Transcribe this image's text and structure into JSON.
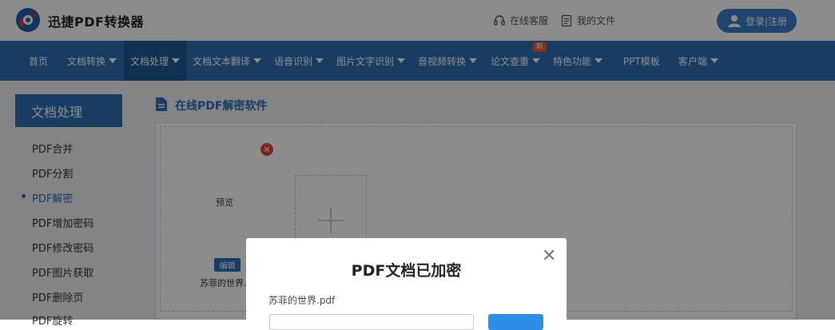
{
  "header": {
    "brand": "迅捷PDF转换器",
    "links": [
      {
        "label": "在线客服"
      },
      {
        "label": "我的文件"
      }
    ],
    "login": "登录|注册"
  },
  "nav": {
    "items": [
      {
        "label": "首页"
      },
      {
        "label": "文档转换"
      },
      {
        "label": "文档处理"
      },
      {
        "label": "文档文本翻译"
      },
      {
        "label": "语音识别"
      },
      {
        "label": "图片文字识别"
      },
      {
        "label": "音视频转换"
      },
      {
        "label": "论文查重"
      },
      {
        "label": "特色功能"
      },
      {
        "label": "PPT模板"
      },
      {
        "label": "客户端"
      }
    ],
    "new_badge": "新"
  },
  "sidebar": {
    "title": "文档处理",
    "items": [
      {
        "label": "PDF合并"
      },
      {
        "label": "PDF分割"
      },
      {
        "label": "PDF解密"
      },
      {
        "label": "PDF增加密码"
      },
      {
        "label": "PDF修改密码"
      },
      {
        "label": "PDF图片获取"
      },
      {
        "label": "PDF删除页"
      },
      {
        "label": "PDF旋转"
      }
    ]
  },
  "main": {
    "title": "在线PDF解密软件",
    "file_card": {
      "preview": "预览",
      "edit": "编辑",
      "name": "苏菲的世界.pdf"
    }
  },
  "modal": {
    "title": "PDF文档已加密",
    "file": "苏菲的世界.pdf"
  },
  "colors": {
    "nav_blue": "#2e6db4",
    "nav_active": "#1f5a9a",
    "accent_orange": "#f05a28",
    "close_red": "#e0483d"
  }
}
